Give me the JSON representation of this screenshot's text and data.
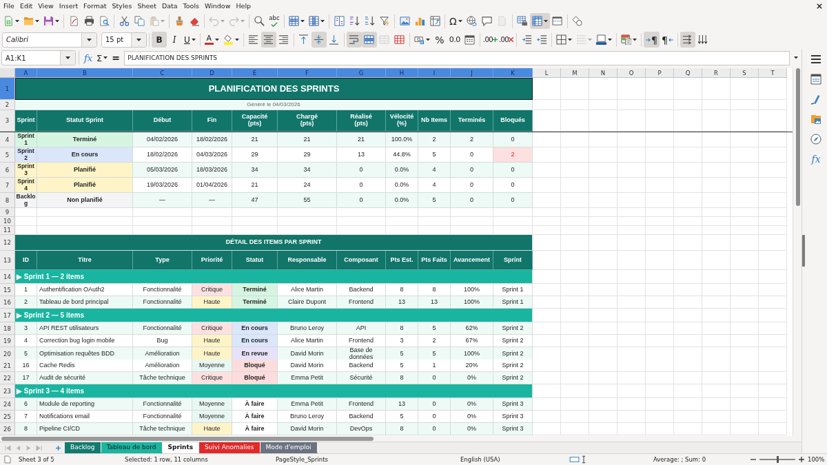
{
  "menu_bar": {
    "items": [
      "File",
      "Edit",
      "View",
      "Insert",
      "Format",
      "Styles",
      "Sheet",
      "Data",
      "Tools",
      "Window",
      "Help"
    ]
  },
  "standard_toolbar": {
    "groups": [
      [
        {
          "kind": "new",
          "dropdown": true,
          "selected": false,
          "disabled": false
        },
        {
          "kind": "open",
          "dropdown": true,
          "selected": false,
          "disabled": false
        },
        {
          "kind": "save",
          "dropdown": true,
          "selected": false,
          "disabled": false
        }
      ],
      [
        {
          "kind": "export-pdf",
          "dropdown": false,
          "selected": false,
          "disabled": false
        },
        {
          "kind": "print",
          "dropdown": false,
          "selected": false,
          "disabled": false
        },
        {
          "kind": "print-preview",
          "dropdown": false,
          "selected": false,
          "disabled": false
        }
      ],
      [
        {
          "kind": "cut",
          "dropdown": false,
          "selected": false,
          "disabled": false
        },
        {
          "kind": "copy",
          "dropdown": false,
          "selected": false,
          "disabled": false
        },
        {
          "kind": "paste",
          "dropdown": true,
          "selected": false,
          "disabled": true
        }
      ],
      [
        {
          "kind": "clone-format",
          "dropdown": false,
          "selected": false,
          "disabled": false
        },
        {
          "kind": "clear-format",
          "dropdown": false,
          "selected": false,
          "disabled": false
        }
      ],
      [
        {
          "kind": "undo",
          "dropdown": true,
          "selected": false,
          "disabled": true
        },
        {
          "kind": "redo",
          "dropdown": true,
          "selected": false,
          "disabled": true
        }
      ],
      [
        {
          "kind": "find-replace",
          "dropdown": false,
          "selected": false,
          "disabled": false
        },
        {
          "kind": "spelling",
          "label": "abc",
          "dropdown": false,
          "selected": false,
          "disabled": false
        }
      ],
      [
        {
          "kind": "rows",
          "dropdown": true,
          "selected": false,
          "disabled": false
        },
        {
          "kind": "columns",
          "dropdown": true,
          "selected": false,
          "disabled": false
        }
      ],
      [
        {
          "kind": "sort",
          "dropdown": false,
          "selected": false,
          "disabled": false
        },
        {
          "kind": "sort-ascending",
          "dropdown": false,
          "selected": false,
          "disabled": false
        },
        {
          "kind": "sort-descending",
          "dropdown": false,
          "selected": false,
          "disabled": false
        },
        {
          "kind": "autofilter",
          "dropdown": false,
          "selected": false,
          "disabled": false
        }
      ],
      [
        {
          "kind": "image",
          "dropdown": false,
          "selected": false,
          "disabled": false
        },
        {
          "kind": "chart",
          "dropdown": false,
          "selected": false,
          "disabled": false
        },
        {
          "kind": "pivot-table",
          "dropdown": false,
          "selected": false,
          "disabled": false
        }
      ],
      [
        {
          "kind": "special-character",
          "label": "Ω",
          "dropdown": true,
          "selected": false,
          "disabled": false
        },
        {
          "kind": "hyperlink",
          "dropdown": false,
          "selected": false,
          "disabled": false
        },
        {
          "kind": "comment",
          "dropdown": false,
          "selected": false,
          "disabled": false
        },
        {
          "kind": "header-footer",
          "dropdown": false,
          "selected": false,
          "disabled": true
        }
      ],
      [
        {
          "kind": "print-area",
          "dropdown": false,
          "selected": false,
          "disabled": false
        },
        {
          "kind": "freeze",
          "dropdown": true,
          "selected": true,
          "disabled": false
        },
        {
          "kind": "split-window",
          "dropdown": false,
          "selected": false,
          "disabled": false
        }
      ],
      [
        {
          "kind": "draw-functions",
          "dropdown": false,
          "selected": false,
          "disabled": false
        }
      ]
    ]
  },
  "formatting_toolbar": {
    "font_name": "Calibri",
    "font_size": "15 pt",
    "groups": [
      [
        {
          "kind": "bold",
          "label": "B",
          "dropdown": false,
          "selected": true,
          "disabled": false
        },
        {
          "kind": "italic",
          "label": "I",
          "dropdown": false,
          "selected": false,
          "disabled": false
        },
        {
          "kind": "underline",
          "label": "U",
          "dropdown": true,
          "selected": false,
          "disabled": false
        }
      ],
      [
        {
          "kind": "font-color",
          "label": "A",
          "dropdown": true,
          "selected": false,
          "disabled": false
        },
        {
          "kind": "highlight",
          "dropdown": true,
          "selected": false,
          "disabled": false
        }
      ],
      [
        {
          "kind": "align-left",
          "dropdown": false,
          "selected": false,
          "disabled": false
        },
        {
          "kind": "align-center",
          "dropdown": false,
          "selected": true,
          "disabled": false
        },
        {
          "kind": "align-right",
          "dropdown": false,
          "selected": false,
          "disabled": false
        }
      ],
      [
        {
          "kind": "align-top",
          "dropdown": false,
          "selected": false,
          "disabled": false
        },
        {
          "kind": "align-middle",
          "dropdown": false,
          "selected": true,
          "disabled": false
        },
        {
          "kind": "align-bottom",
          "dropdown": false,
          "selected": false,
          "disabled": false
        }
      ],
      [
        {
          "kind": "wrap",
          "dropdown": false,
          "selected": true,
          "disabled": false
        },
        {
          "kind": "merge-center",
          "dropdown": false,
          "selected": true,
          "disabled": false
        },
        {
          "kind": "merge",
          "dropdown": false,
          "selected": false,
          "disabled": true
        },
        {
          "kind": "unmerge",
          "dropdown": false,
          "selected": false,
          "disabled": false
        }
      ],
      [
        {
          "kind": "number-format",
          "dropdown": true,
          "selected": false,
          "disabled": false
        },
        {
          "kind": "percent",
          "label": "%",
          "dropdown": false,
          "selected": false,
          "disabled": false
        },
        {
          "kind": "decimal",
          "label": "0.0",
          "dropdown": false,
          "selected": false,
          "disabled": false
        },
        {
          "kind": "date",
          "dropdown": false,
          "selected": false,
          "disabled": false
        }
      ],
      [
        {
          "kind": "add-decimal",
          "label": ".00",
          "dropdown": false,
          "selected": false,
          "disabled": false
        },
        {
          "kind": "delete-decimal",
          "label": ".00",
          "dropdown": false,
          "selected": false,
          "disabled": false
        }
      ],
      [
        {
          "kind": "indent-increase",
          "dropdown": false,
          "selected": false,
          "disabled": false
        },
        {
          "kind": "indent-decrease",
          "dropdown": false,
          "selected": false,
          "disabled": false
        }
      ],
      [
        {
          "kind": "borders",
          "dropdown": true,
          "selected": false,
          "disabled": false
        },
        {
          "kind": "border-style",
          "dropdown": true,
          "selected": false,
          "disabled": true
        },
        {
          "kind": "border-color",
          "dropdown": true,
          "selected": false,
          "disabled": false
        }
      ],
      [
        {
          "kind": "conditional",
          "dropdown": true,
          "selected": false,
          "disabled": false
        }
      ],
      [
        {
          "kind": "left-to-right",
          "label": "¶",
          "dropdown": false,
          "selected": true,
          "disabled": false
        },
        {
          "kind": "right-to-left",
          "label": "¶",
          "dropdown": false,
          "selected": false,
          "disabled": false
        }
      ],
      [
        {
          "kind": "text-horizontal",
          "dropdown": false,
          "selected": true,
          "disabled": false
        },
        {
          "kind": "text-vertical",
          "dropdown": false,
          "selected": false,
          "disabled": false
        }
      ]
    ]
  },
  "formula_bar": {
    "name_box": "A1:K1",
    "tools": [
      {
        "kind": "function-wizard",
        "label": "fx",
        "dropdown": false,
        "selected": false,
        "disabled": false
      },
      {
        "kind": "sum",
        "label": "Σ",
        "dropdown": true,
        "selected": false,
        "disabled": false
      },
      {
        "kind": "formula",
        "label": "=",
        "dropdown": false,
        "selected": false,
        "disabled": false
      }
    ],
    "formula": "PLANIFICATION DES SPRINTS"
  },
  "sidebar": {
    "items": [
      {
        "kind": "menu",
        "selected": false
      },
      {
        "kind": "properties",
        "selected": false
      },
      {
        "kind": "styles",
        "selected": false
      },
      {
        "kind": "gallery",
        "selected": false
      },
      {
        "kind": "navigator",
        "selected": false
      },
      {
        "kind": "functions",
        "label": "fx",
        "selected": false
      }
    ]
  },
  "sheet": {
    "columns": [
      {
        "label": "A",
        "selected": true
      },
      {
        "label": "B",
        "selected": true
      },
      {
        "label": "C",
        "selected": true
      },
      {
        "label": "D",
        "selected": true
      },
      {
        "label": "E",
        "selected": true
      },
      {
        "label": "F",
        "selected": true
      },
      {
        "label": "G",
        "selected": true
      },
      {
        "label": "H",
        "selected": true
      },
      {
        "label": "I",
        "selected": true
      },
      {
        "label": "J",
        "selected": true
      },
      {
        "label": "K",
        "selected": true
      },
      {
        "label": "L",
        "selected": false
      },
      {
        "label": "M",
        "selected": false
      },
      {
        "label": "N",
        "selected": false
      },
      {
        "label": "O",
        "selected": false
      },
      {
        "label": "P",
        "selected": false
      },
      {
        "label": "Q",
        "selected": false
      },
      {
        "label": "R",
        "selected": false
      },
      {
        "label": "S",
        "selected": false
      },
      {
        "label": "T",
        "selected": false
      }
    ],
    "rows": [
      {
        "label": "1",
        "selected": true
      },
      {
        "label": "2",
        "selected": false
      },
      {
        "label": "3",
        "selected": false
      },
      {
        "label": "4",
        "selected": false
      },
      {
        "label": "5",
        "selected": false
      },
      {
        "label": "6",
        "selected": false
      },
      {
        "label": "7",
        "selected": false
      },
      {
        "label": "8",
        "selected": false
      },
      {
        "label": "9",
        "selected": false
      },
      {
        "label": "10",
        "selected": false
      },
      {
        "label": "11",
        "selected": false
      },
      {
        "label": "12",
        "selected": false
      },
      {
        "label": "13",
        "selected": false
      },
      {
        "label": "14",
        "selected": false
      },
      {
        "label": "15",
        "selected": false
      },
      {
        "label": "16",
        "selected": false
      },
      {
        "label": "17",
        "selected": false
      },
      {
        "label": "18",
        "selected": false
      },
      {
        "label": "19",
        "selected": false
      },
      {
        "label": "20",
        "selected": false
      },
      {
        "label": "21",
        "selected": false
      },
      {
        "label": "22",
        "selected": false
      },
      {
        "label": "23",
        "selected": false
      },
      {
        "label": "24",
        "selected": false
      },
      {
        "label": "25",
        "selected": false
      },
      {
        "label": "26",
        "selected": false
      }
    ],
    "title": "PLANIFICATION DES SPRINTS",
    "subtitle": "Généré le 04/03/2026",
    "summary_table": {
      "columns": [
        "Sprint",
        "Statut Sprint",
        "Début",
        "Fin",
        "Capacité\n(pts)",
        "Chargé\n(pts)",
        "Réalisé\n(pts)",
        "Vélocité\n(%)",
        "Nb Items",
        "Terminés",
        "Bloqués"
      ],
      "rows": [
        {
          "sprint": "Sprint 1",
          "status": {
            "text": "Terminé",
            "color": "#d6f5e1"
          },
          "start": "04/02/2026",
          "end": "18/02/2026",
          "capacity": "21",
          "charged": "21",
          "done": "21",
          "velocity": "100.0%",
          "items": "2",
          "completed": "2",
          "blocked": "0",
          "blocked_alert": false
        },
        {
          "sprint": "Sprint 2",
          "status": {
            "text": "En cours",
            "color": "#dae6fa"
          },
          "start": "18/02/2026",
          "end": "04/03/2026",
          "capacity": "29",
          "charged": "29",
          "done": "13",
          "velocity": "44.8%",
          "items": "5",
          "completed": "0",
          "blocked": "2",
          "blocked_alert": true
        },
        {
          "sprint": "Sprint 3",
          "status": {
            "text": "Planifié",
            "color": "#fff4c8"
          },
          "start": "05/03/2026",
          "end": "18/03/2026",
          "capacity": "34",
          "charged": "34",
          "done": "0",
          "velocity": "0.0%",
          "items": "4",
          "completed": "0",
          "blocked": "0",
          "blocked_alert": false
        },
        {
          "sprint": "Sprint 4",
          "status": {
            "text": "Planifié",
            "color": "#fff4c8"
          },
          "start": "19/03/2026",
          "end": "01/04/2026",
          "capacity": "21",
          "charged": "24",
          "done": "0",
          "velocity": "0.0%",
          "items": "4",
          "completed": "0",
          "blocked": "0",
          "blocked_alert": false
        },
        {
          "sprint": "Backlog",
          "status": {
            "text": "Non planifié",
            "color": "#f4f4f4"
          },
          "start": "—",
          "end": "—",
          "capacity": "47",
          "charged": "55",
          "done": "0",
          "velocity": "0.0%",
          "items": "5",
          "completed": "0",
          "blocked": "0",
          "blocked_alert": false
        }
      ]
    },
    "detail_table": {
      "title": "DÉTAIL DES ITEMS PAR SPRINT",
      "columns": [
        "ID",
        "Titre",
        "Type",
        "Priorité",
        "Statut",
        "Responsable",
        "Composant",
        "Pts Est.",
        "Pts Faits",
        "Avancement",
        "Sprint"
      ],
      "groups": [
        {
          "label": "▶ Sprint 1 — 2 items",
          "items": [
            {
              "id": "1",
              "title": "Authentification OAuth2",
              "type": "Fonctionnalité",
              "priority": {
                "text": "Critique",
                "color": "#fde1e1"
              },
              "status": {
                "text": "Terminé",
                "color": "#d6f5e1"
              },
              "owner": "Alice Martin",
              "component": "Backend",
              "estimate": "8",
              "done": "8",
              "progress": "100%",
              "sprint": "Sprint 1"
            },
            {
              "id": "2",
              "title": "Tableau de bord principal",
              "type": "Fonctionnalité",
              "priority": {
                "text": "Haute",
                "color": "#fff4c8"
              },
              "status": {
                "text": "Terminé",
                "color": "#d6f5e1"
              },
              "owner": "Claire Dupont",
              "component": "Frontend",
              "estimate": "13",
              "done": "13",
              "progress": "100%",
              "sprint": "Sprint 1"
            }
          ]
        },
        {
          "label": "▶ Sprint 2 — 5 items",
          "items": [
            {
              "id": "3",
              "title": "API REST utilisateurs",
              "type": "Fonctionnalité",
              "priority": {
                "text": "Critique",
                "color": "#fde1e1"
              },
              "status": {
                "text": "En cours",
                "color": "#dae6fa"
              },
              "owner": "Bruno Leroy",
              "component": "API",
              "estimate": "8",
              "done": "5",
              "progress": "62%",
              "sprint": "Sprint 2"
            },
            {
              "id": "4",
              "title": "Correction bug login mobile",
              "type": "Bug",
              "priority": {
                "text": "Haute",
                "color": "#fff4c8"
              },
              "status": {
                "text": "En cours",
                "color": "#dae6fa"
              },
              "owner": "Alice Martin",
              "component": "Frontend",
              "estimate": "3",
              "done": "2",
              "progress": "67%",
              "sprint": "Sprint 2"
            },
            {
              "id": "5",
              "title": "Optimisation requêtes BDD",
              "type": "Amélioration",
              "priority": {
                "text": "Haute",
                "color": "#fff4c8"
              },
              "status": {
                "text": "En revue",
                "color": "#e6e2fa"
              },
              "owner": "David Morin",
              "component": "Base de données",
              "estimate": "5",
              "done": "5",
              "progress": "100%",
              "sprint": "Sprint 2"
            },
            {
              "id": "16",
              "title": "Cache Redis",
              "type": "Amélioration",
              "priority": {
                "text": "Moyenne",
                "color": "#e9f7f2"
              },
              "status": {
                "text": "Bloqué",
                "color": "#fcdcdc"
              },
              "owner": "David Morin",
              "component": "Backend",
              "estimate": "5",
              "done": "1",
              "progress": "20%",
              "sprint": "Sprint 2"
            },
            {
              "id": "17",
              "title": "Audit de sécurité",
              "type": "Tâche technique",
              "priority": {
                "text": "Critique",
                "color": "#fde1e1"
              },
              "status": {
                "text": "Bloqué",
                "color": "#fcdcdc"
              },
              "owner": "Emma Petit",
              "component": "Sécurité",
              "estimate": "8",
              "done": "0",
              "progress": "0%",
              "sprint": "Sprint 2"
            }
          ]
        },
        {
          "label": "▶ Sprint 3 — 4 items",
          "items": [
            {
              "id": "6",
              "title": "Module de reporting",
              "type": "Fonctionnalité",
              "priority": {
                "text": "Moyenne",
                "color": "#e9f7f2"
              },
              "status": {
                "text": "À faire",
                "color": "#ffffff"
              },
              "owner": "Emma Petit",
              "component": "Frontend",
              "estimate": "13",
              "done": "0",
              "progress": "0%",
              "sprint": "Sprint 3"
            },
            {
              "id": "7",
              "title": "Notifications email",
              "type": "Fonctionnalité",
              "priority": {
                "text": "Moyenne",
                "color": "#e9f7f2"
              },
              "status": {
                "text": "À faire",
                "color": "#ffffff"
              },
              "owner": "Bruno Leroy",
              "component": "Backend",
              "estimate": "5",
              "done": "0",
              "progress": "0%",
              "sprint": "Sprint 3"
            },
            {
              "id": "8",
              "title": "Pipeline CI/CD",
              "type": "Tâche technique",
              "priority": {
                "text": "Haute",
                "color": "#fff4c8"
              },
              "status": {
                "text": "À faire",
                "color": "#ffffff"
              },
              "owner": "David Morin",
              "component": "DevOps",
              "estimate": "8",
              "done": "0",
              "progress": "0%",
              "sprint": "Sprint 3"
            }
          ]
        }
      ]
    }
  },
  "sheet_tabs": {
    "navigation": [
      {
        "kind": "first",
        "disabled": true
      },
      {
        "kind": "previous",
        "disabled": true
      },
      {
        "kind": "next",
        "disabled": true
      },
      {
        "kind": "last",
        "disabled": true
      }
    ],
    "tabs": [
      {
        "label": "Backlog",
        "color": "#137a6f",
        "selected": false
      },
      {
        "label": "Tableau de bord",
        "color": "#1cb5a0",
        "selected": false
      },
      {
        "label": "Sprints",
        "selected": true
      },
      {
        "label": "Suivi Anomalies",
        "color": "#e02a2a",
        "selected": false
      },
      {
        "label": "Mode d'emploi",
        "color": "#6b7380",
        "selected": false
      }
    ]
  },
  "status_bar": {
    "sheet_position": "Sheet 3 of 5",
    "selection": "Selected: 1 row, 11 columns",
    "page_style": "PageStyle_Sprints",
    "language": "English (USA)",
    "totals": "Average: ; Sum: 0",
    "zoom": {
      "level": 0.5,
      "reading": "100%"
    }
  }
}
